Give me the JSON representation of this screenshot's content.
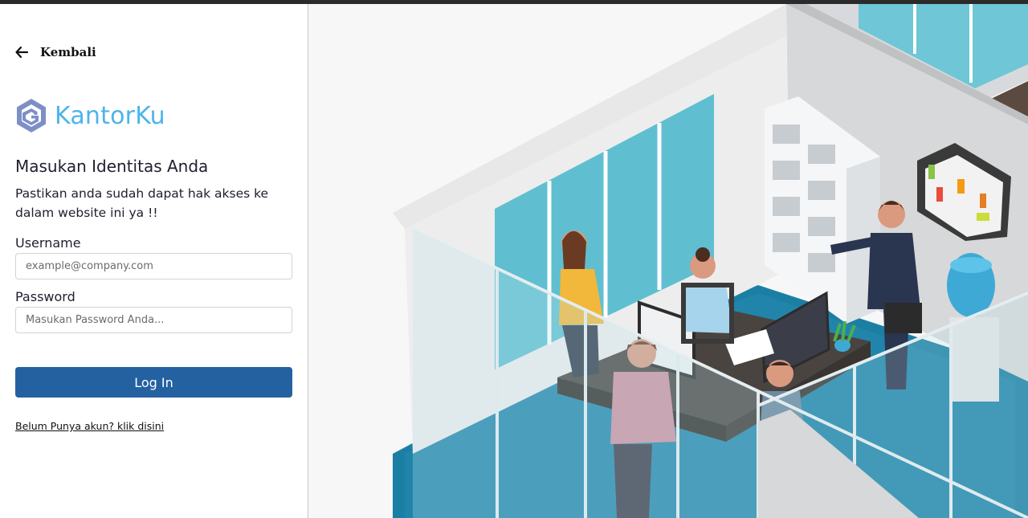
{
  "back": {
    "label": "Kembali",
    "icon": "arrow-left-icon"
  },
  "brand": {
    "name": "KantorKu",
    "logo_icon": "hexagon-g-logo-icon",
    "color": "#4db4ea"
  },
  "form": {
    "title": "Masukan Identitas Anda",
    "subtitle": "Pastikan anda sudah dapat hak akses ke dalam website ini ya !!",
    "username": {
      "label": "Username",
      "placeholder": "example@company.com",
      "value": ""
    },
    "password": {
      "label": "Password",
      "placeholder": "Masukan Password Anda...",
      "value": ""
    },
    "submit_label": "Log In",
    "register_link": "Belum Punya akun? klik disini"
  },
  "colors": {
    "primary_button": "#2461a0",
    "accent_teal": "#1b7fa3",
    "illustration_bg": "#f7f7f7"
  }
}
